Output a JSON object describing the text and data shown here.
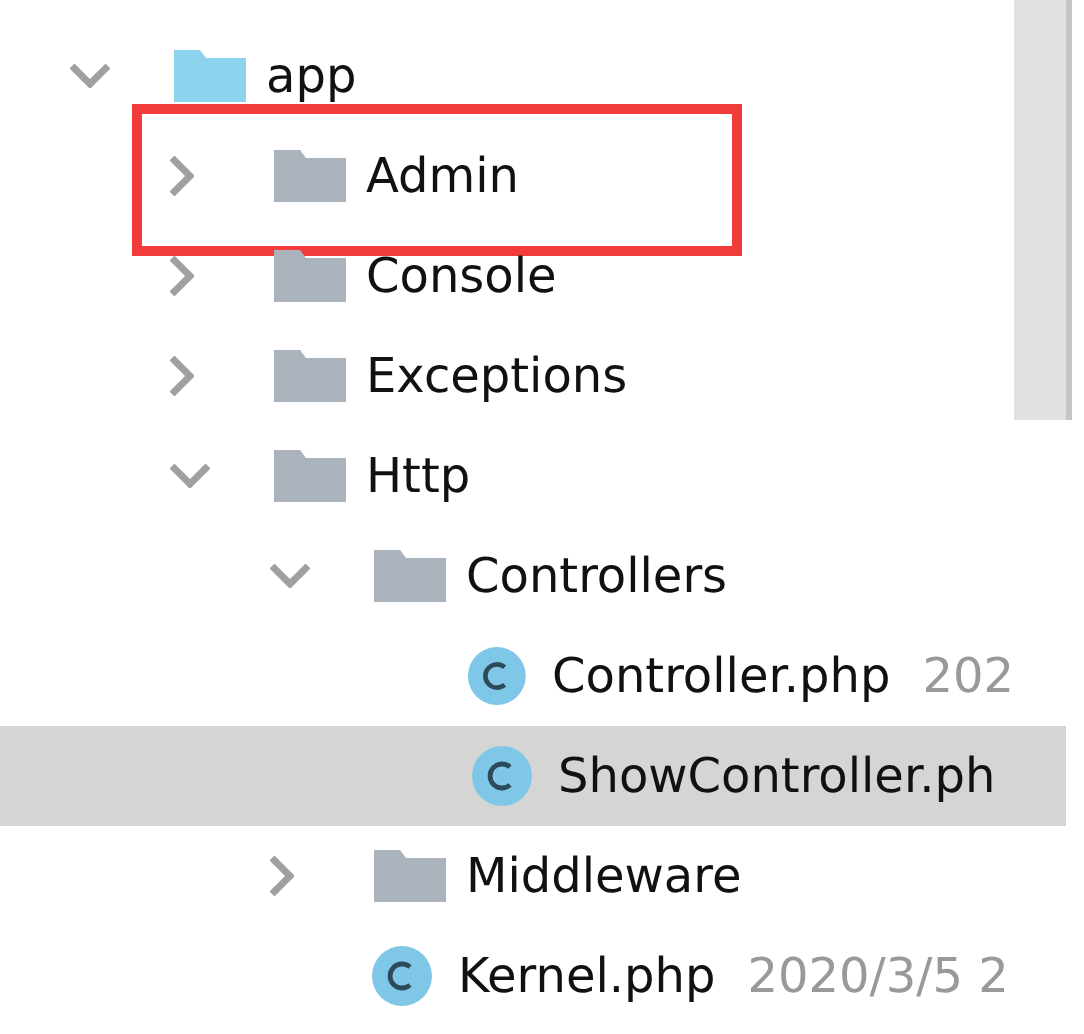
{
  "tree": [
    {
      "kind": "source-folder",
      "name": "app",
      "expanded": true,
      "selected": false,
      "children": [
        {
          "kind": "folder",
          "name": "Admin",
          "expanded": false,
          "selected": false,
          "highlighted": true
        },
        {
          "kind": "folder",
          "name": "Console",
          "expanded": false,
          "selected": false
        },
        {
          "kind": "folder",
          "name": "Exceptions",
          "expanded": false,
          "selected": false
        },
        {
          "kind": "folder",
          "name": "Http",
          "expanded": true,
          "selected": false,
          "children": [
            {
              "kind": "folder",
              "name": "Controllers",
              "expanded": true,
              "selected": false,
              "children": [
                {
                  "kind": "php-file",
                  "name": "Controller.php",
                  "date": "202",
                  "selected": false
                },
                {
                  "kind": "php-file",
                  "name": "ShowController.ph",
                  "selected": true
                }
              ]
            },
            {
              "kind": "folder",
              "name": "Middleware",
              "expanded": false,
              "selected": false
            },
            {
              "kind": "php-file",
              "name": "Kernel.php",
              "date": "2020/3/5 2",
              "selected": false
            }
          ]
        }
      ]
    }
  ]
}
